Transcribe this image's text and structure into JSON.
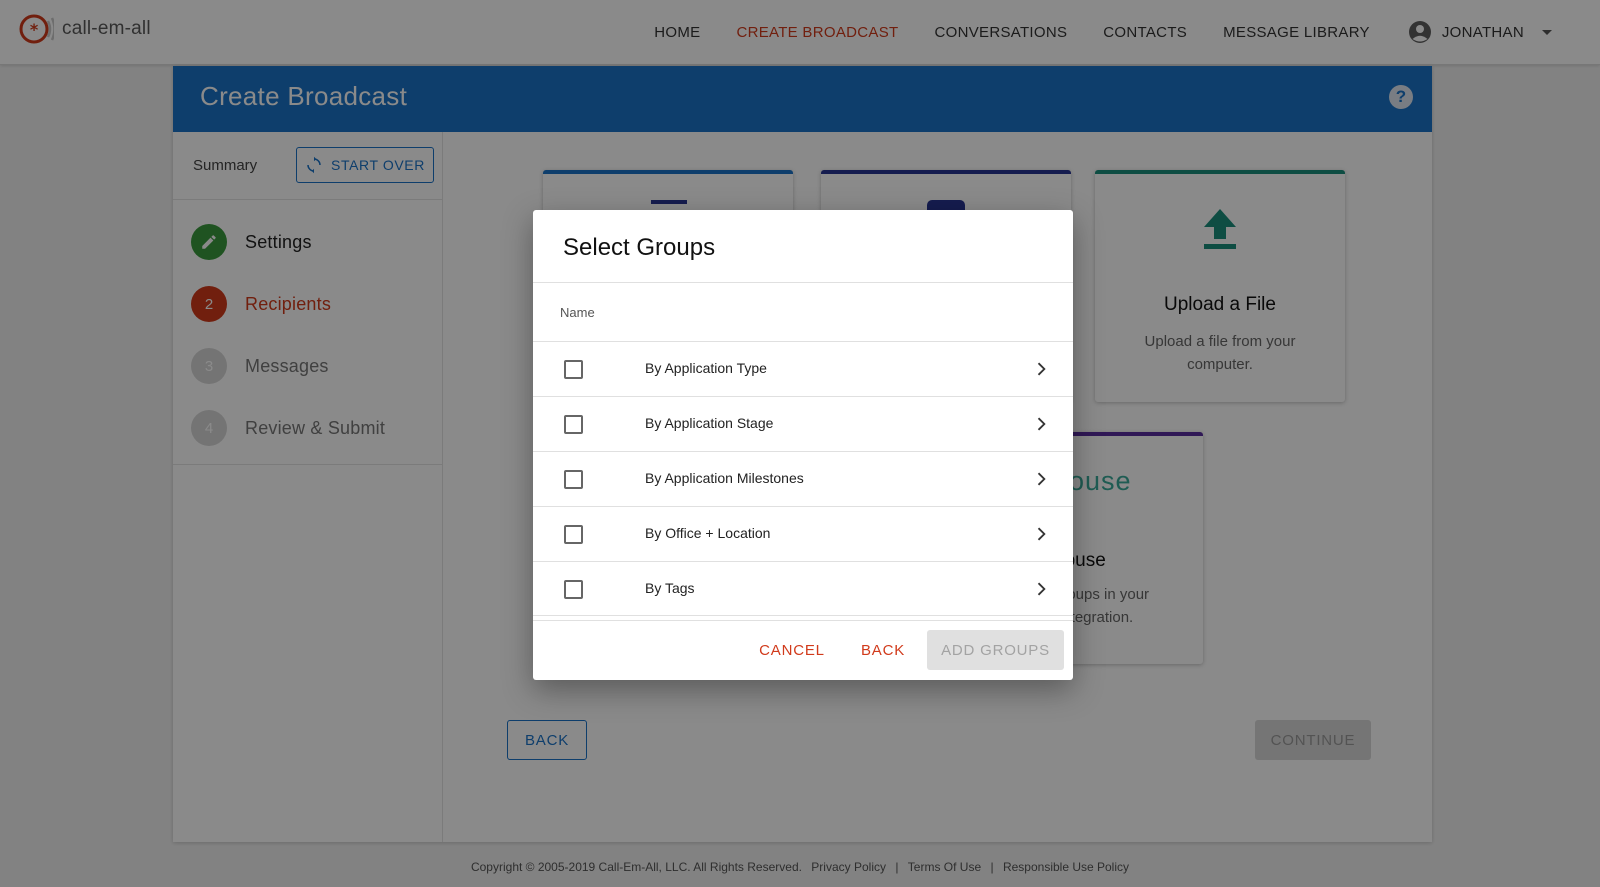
{
  "app": {
    "logo_text": "call-em-all"
  },
  "nav": {
    "items": [
      {
        "label": "HOME"
      },
      {
        "label": "CREATE BROADCAST"
      },
      {
        "label": "CONVERSATIONS"
      },
      {
        "label": "CONTACTS"
      },
      {
        "label": "MESSAGE LIBRARY"
      }
    ],
    "active_index": 1,
    "user_name": "JONATHAN"
  },
  "page": {
    "title": "Create Broadcast",
    "help_glyph": "?"
  },
  "sidebar": {
    "summary_label": "Summary",
    "start_over_label": "START OVER",
    "steps": [
      {
        "number": "",
        "label": "Settings",
        "state": "done"
      },
      {
        "number": "2",
        "label": "Recipients",
        "state": "active"
      },
      {
        "number": "3",
        "label": "Messages",
        "state": "pending"
      },
      {
        "number": "4",
        "label": "Review & Submit",
        "state": "pending"
      }
    ]
  },
  "cards": {
    "upload": {
      "title": "Upload a File",
      "description": "Upload a file from your computer."
    },
    "greenhouse": {
      "brand": "house",
      "title": "house",
      "description_line1": "groups in your",
      "description_line2": "integration."
    }
  },
  "main": {
    "back_label": "BACK",
    "continue_label": "CONTINUE"
  },
  "dialog": {
    "title": "Select Groups",
    "column_header": "Name",
    "rows": [
      {
        "label": "By Application Type"
      },
      {
        "label": "By Application Stage"
      },
      {
        "label": "By Application Milestones"
      },
      {
        "label": "By Office + Location"
      },
      {
        "label": "By Tags"
      }
    ],
    "cancel_label": "CANCEL",
    "back_label": "BACK",
    "add_label": "ADD GROUPS"
  },
  "footer": {
    "copyright": "Copyright © 2005-2019 Call-Em-All, LLC. All Rights Reserved.",
    "privacy": "Privacy Policy",
    "terms": "Terms Of Use",
    "responsible": "Responsible Use Policy",
    "separator": "|"
  },
  "colors": {
    "brand_red": "#d13a1b",
    "header_blue": "#1a73c8",
    "step_done": "#3a9a3e",
    "step_active": "#d13a1b",
    "step_pending": "#d6d6d6",
    "upload_teal": "#1b8f7c",
    "card_purple": "#5a2ea0",
    "card_navy": "#283593"
  }
}
